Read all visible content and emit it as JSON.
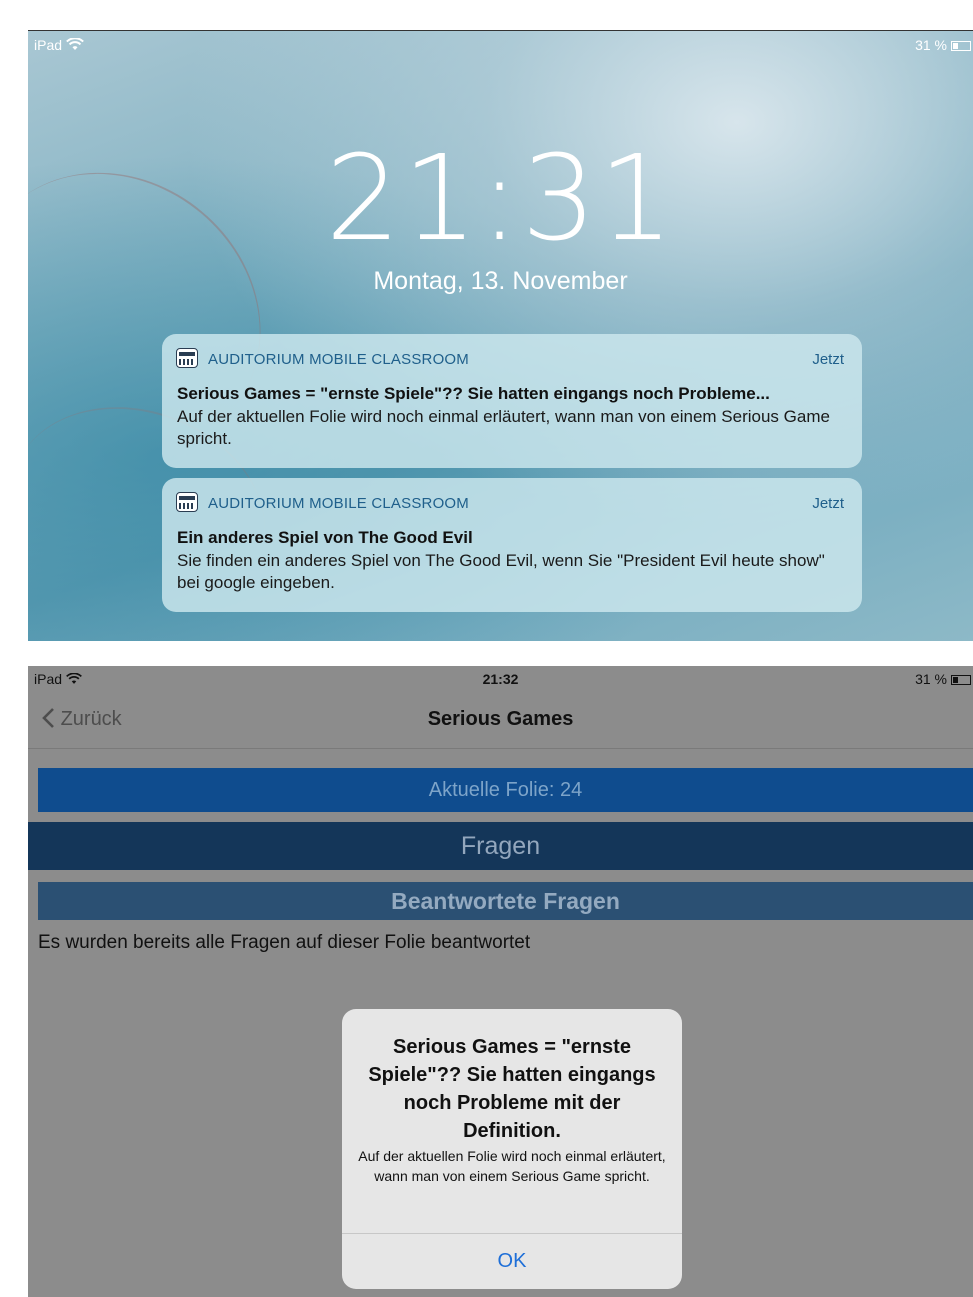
{
  "lock_screen": {
    "status": {
      "device": "iPad",
      "battery": "31 %"
    },
    "time": "21:31",
    "date": "Montag, 13. November",
    "notifications": [
      {
        "app": "AUDITORIUM MOBILE CLASSROOM",
        "time": "Jetzt",
        "title": "Serious Games = \"ernste Spiele\"?? Sie hatten eingangs noch Probleme...",
        "body": "Auf der aktuellen Folie wird noch einmal erläutert, wann man von einem Serious Game spricht."
      },
      {
        "app": "AUDITORIUM MOBILE CLASSROOM",
        "time": "Jetzt",
        "title": "Ein anderes Spiel von The Good Evil",
        "body": "Sie finden ein anderes Spiel von The Good Evil, wenn Sie \"President Evil heute show\" bei google eingeben."
      }
    ]
  },
  "app_screen": {
    "status": {
      "device": "iPad",
      "time": "21:32",
      "battery": "31 %"
    },
    "nav": {
      "back_label": "Zurück",
      "title": "Serious Games"
    },
    "current_slide_label": "Aktuelle Folie: 24",
    "questions_header": "Fragen",
    "answered_header": "Beantwortete Fragen",
    "answered_message": "Es wurden bereits alle Fragen auf dieser Folie beantwortet",
    "alert": {
      "title": "Serious Games = \"ernste Spiele\"?? Sie hatten eingangs noch Probleme mit der Definition.",
      "message": "Auf der aktuellen Folie wird noch einmal erläutert, wann man von einem Serious Game spricht.",
      "button": "OK"
    }
  },
  "colors": {
    "link_blue": "#1e6fd8",
    "slide_bar": "#0f4c8e",
    "questions_bar": "#143659",
    "answered_bar": "#2b5073"
  }
}
